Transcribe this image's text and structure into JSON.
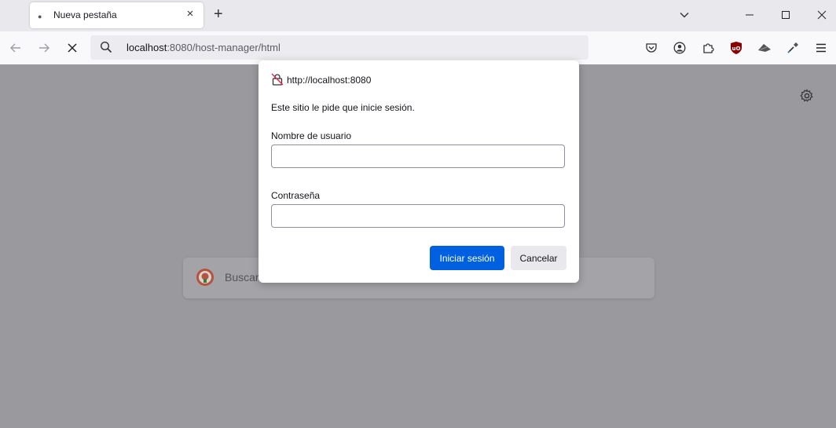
{
  "tabs": [
    {
      "title": "Nueva pestaña",
      "close_icon": "×"
    }
  ],
  "new_tab_icon": "+",
  "urlbar": {
    "host": "localhost",
    "rest": ":8080/host-manager/html"
  },
  "search": {
    "placeholder": "Buscar"
  },
  "dialog": {
    "origin": "http://localhost:8080",
    "message": "Este sitio le pide que inicie sesión.",
    "username_label": "Nombre de usuario",
    "username_value": "",
    "password_label": "Contraseña",
    "password_value": "",
    "login_label": "Iniciar sesión",
    "cancel_label": "Cancelar"
  },
  "colors": {
    "accent": "#0061e0",
    "overlay": "#9a999e",
    "ublock": "#8b0000"
  }
}
